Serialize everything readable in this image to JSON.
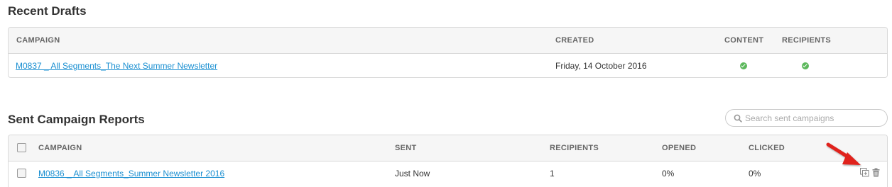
{
  "drafts": {
    "title": "Recent Drafts",
    "columns": {
      "campaign": "CAMPAIGN",
      "created": "CREATED",
      "content": "CONTENT",
      "recipients": "RECIPIENTS"
    },
    "rows": [
      {
        "campaign": "M0837 _ All Segments_The Next Summer Newsletter",
        "created": "Friday, 14 October 2016",
        "content_ok": true,
        "recipients_ok": true
      }
    ]
  },
  "sent": {
    "title": "Sent Campaign Reports",
    "search": {
      "placeholder": "Search sent campaigns",
      "value": ""
    },
    "columns": {
      "campaign": "CAMPAIGN",
      "sent": "SENT",
      "recipients": "RECIPIENTS",
      "opened": "OPENED",
      "clicked": "CLICKED"
    },
    "rows": [
      {
        "campaign": "M0836 _ All Segments_Summer Newsletter 2016",
        "sent": "Just Now",
        "recipients": "1",
        "opened": "0%",
        "clicked": "0%"
      }
    ]
  },
  "icons": {
    "status_ok": "check-circle-icon",
    "copy": "copy-icon",
    "delete": "trash-icon",
    "pointer": "red-arrow-icon",
    "search": "search-icon"
  },
  "colors": {
    "link": "#1a8fd1",
    "ok": "#5cb85c",
    "arrow": "#e0201b",
    "header_bg": "#f6f6f6",
    "border": "#d9d9d9"
  }
}
